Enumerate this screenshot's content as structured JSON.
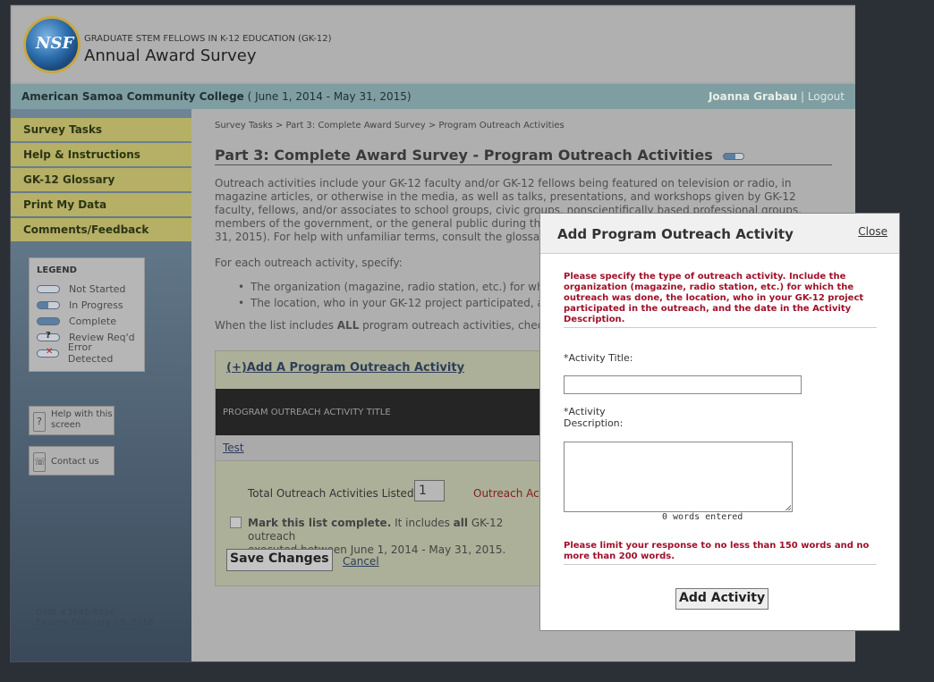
{
  "header": {
    "logo_text": "NSF",
    "program": "GRADUATE STEM FELLOWS IN K-12 EDUCATION (GK-12)",
    "title": "Annual Award Survey"
  },
  "orgbar": {
    "org": "American Samoa Community College",
    "period": "( June 1, 2014 - May 31, 2015)",
    "user": "Joanna Grabau",
    "separator": "|",
    "logout": "Logout"
  },
  "sidebar": {
    "nav": [
      {
        "label": "Survey Tasks"
      },
      {
        "label": "Help & Instructions"
      },
      {
        "label": "GK-12 Glossary"
      },
      {
        "label": "Print My Data"
      },
      {
        "label": "Comments/Feedback"
      }
    ],
    "legend": {
      "title": "LEGEND",
      "items": [
        "Not Started",
        "In Progress",
        "Complete",
        "Review Req'd",
        "Error Detected"
      ]
    },
    "help_label": "Help with this screen",
    "contact_label": "Contact us",
    "omb": "OMB #3145-0226",
    "expires": "Expires February 29, 2016"
  },
  "main": {
    "breadcrumb": "Survey Tasks > Part 3: Complete Award Survey > Program Outreach Activities",
    "title": "Part 3: Complete Award Survey - Program Outreach Activities",
    "intro": "Outreach activities include your GK-12 faculty and/or GK-12 fellows being featured on television or radio, in magazine articles, or otherwise in the media, as well as talks, presentations, and workshops given by GK-12 faculty, fellows, and/or associates to school groups, civic groups, nonscientifically based professional groups, members of the government, or the general public during the",
    "intro_end": "31, 2015). For help with unfamiliar terms, consult the glossa",
    "for_each": "For each outreach activity, specify:",
    "bullets": [
      "The organization (magazine, radio station, etc.) for whi",
      "The location, who in your GK-12 project participated, a"
    ],
    "when_prefix": "When the list includes ",
    "when_bold": "ALL",
    "when_suffix": " program outreach activities, chec",
    "add_link": "(+)Add A Program Outreach Activity",
    "table_header": "PROGRAM OUTREACH ACTIVITY TITLE",
    "rows": [
      "Test"
    ],
    "total_label": "Total Outreach Activities Listed:",
    "total_value": "1",
    "total_note": "Outreach Act",
    "mark_bold": "Mark this list complete.",
    "mark_mid": " It includes ",
    "mark_all": "all",
    "mark_rest": " GK-12 outreach",
    "mark_line2": "executed between June 1, 2014 - May 31, 2015.",
    "save": "Save Changes",
    "cancel": "Cancel"
  },
  "modal": {
    "title": "Add Program Outreach Activity",
    "close": "Close",
    "instructions": "Please specify the type of outreach activity. Include the organization (magazine, radio station, etc.) for which the outreach was done, the location, who in your GK-12 project participated in the outreach, and the date in the Activity Description.",
    "title_label": "*Activity Title:",
    "title_value": "",
    "desc_label_1": "*Activity",
    "desc_label_2": "Description:",
    "desc_value": "",
    "word_count": "0 words entered",
    "limit_note": "Please limit your response to no less than 150 words and no more than 200 words.",
    "submit": "Add Activity"
  }
}
